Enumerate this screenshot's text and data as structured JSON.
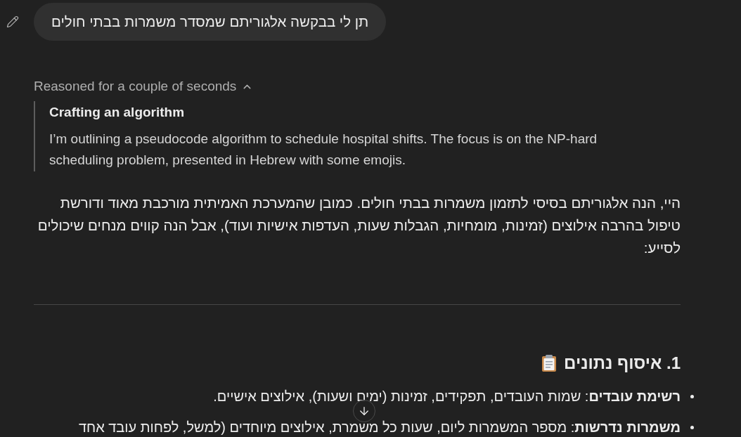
{
  "user_message": {
    "text": "תן לי בבקשה אלגוריתם שמסדר משמרות בבתי חולים"
  },
  "reasoning": {
    "summary": "Reasoned for a couple of seconds",
    "expanded": true,
    "title": "Crafting an algorithm",
    "text": "I’m outlining a pseudocode algorithm to schedule hospital shifts. The focus is on the NP-hard scheduling problem, presented in Hebrew with some emojis."
  },
  "intro": "היי, הנה אלגוריתם בסיסי לתזמון משמרות בבתי חולים. כמובן שהמערכת האמיתית מורכבת מאוד ודורשת טיפול בהרבה אילוצים (זמינות, מומחיות, הגבלות שעות, העדפות אישיות ועוד), אבל הנה קווים מנחים שיכולים לסייע:",
  "section": {
    "heading": "1. איסוף נתונים",
    "items": [
      {
        "text": "**רשימת עובדים**: שמות העובדים, תפקידים, זמינות (ימים ושעות), אילוצים אישיים."
      },
      {
        "text": "**משמרות נדרשות**: מספר המשמרות ליום, שעות כל משמרת, אילוצים מיוחדים (למשל, לפחות עובד אחד"
      }
    ]
  }
}
